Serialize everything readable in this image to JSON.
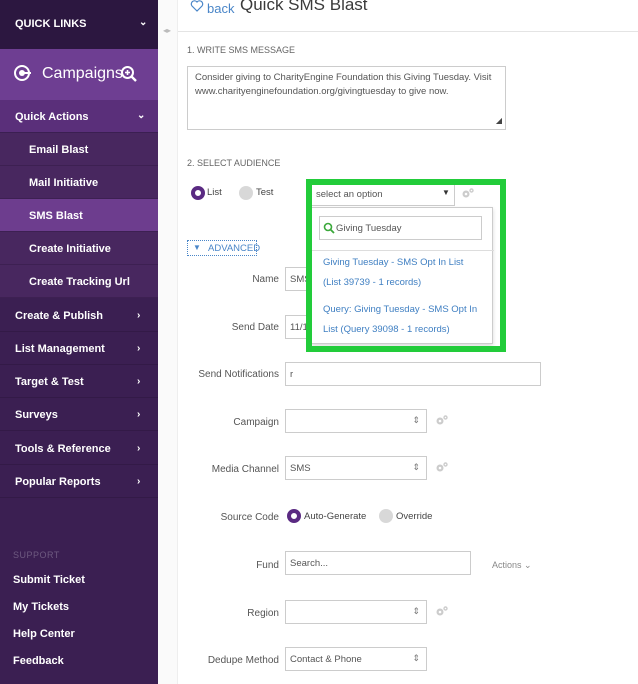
{
  "sidebar": {
    "quick_links": "QUICK LINKS",
    "section": "Campaigns",
    "quick_actions": "Quick Actions",
    "sub_items": [
      "Email Blast",
      "Mail Initiative",
      "SMS Blast",
      "Create Initiative",
      "Create Tracking Url"
    ],
    "categories": [
      "Create & Publish",
      "List Management",
      "Target & Test",
      "Surveys",
      "Tools & Reference",
      "Popular Reports"
    ],
    "support_label": "SUPPORT",
    "support_links": [
      "Submit Ticket",
      "My Tickets",
      "Help Center",
      "Feedback"
    ]
  },
  "header": {
    "back": "back",
    "title": "Quick SMS Blast"
  },
  "step1": {
    "label": "1. WRITE SMS MESSAGE",
    "message": "Consider giving to CharityEngine Foundation this Giving Tuesday. Visit www.charityenginefoundation.org/givingtuesday to give now."
  },
  "step2": {
    "label": "2. SELECT AUDIENCE",
    "radio_list": "List",
    "radio_test": "Test",
    "select_placeholder": "select an option"
  },
  "dropdown": {
    "search_value": "Giving Tuesday",
    "options": [
      "Giving Tuesday - SMS Opt In List (List 39739 - 1 records)",
      "Query: Giving Tuesday - SMS Opt In List (Query 39098 - 1 records)"
    ]
  },
  "advanced": {
    "toggle": "ADVANCED",
    "name_label": "Name",
    "name_value": "SMS",
    "send_date_label": "Send Date",
    "send_date_value": "11/1",
    "send_notifications_label": "Send Notifications",
    "send_notifications_value": "r",
    "campaign_label": "Campaign",
    "campaign_value": "",
    "media_channel_label": "Media Channel",
    "media_channel_value": "SMS",
    "source_code_label": "Source Code",
    "source_auto": "Auto-Generate",
    "source_override": "Override",
    "fund_label": "Fund",
    "fund_placeholder": "Search...",
    "actions": "Actions",
    "region_label": "Region",
    "region_value": "",
    "dedupe_label": "Dedupe Method",
    "dedupe_value": "Contact & Phone"
  },
  "colors": {
    "sidebar": "#3b1f52",
    "accent": "#5a2a82",
    "link": "#4a86c8",
    "highlight": "#22cc3a"
  }
}
